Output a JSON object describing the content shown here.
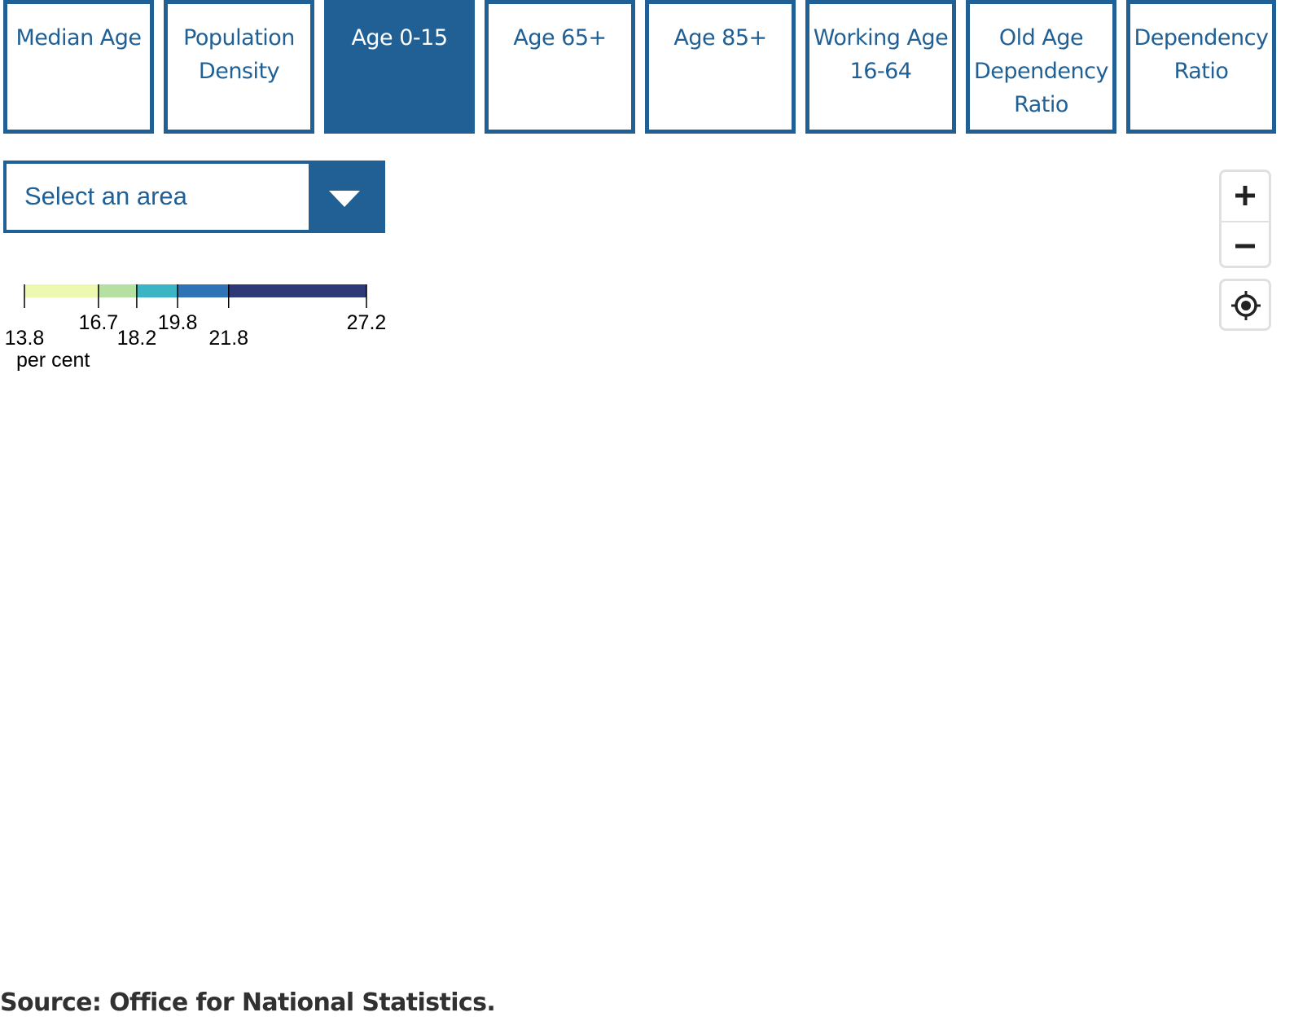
{
  "tabs": [
    {
      "label": "Median Age",
      "active": false
    },
    {
      "label": "Population\nDensity",
      "active": false
    },
    {
      "label": "Age 0-15",
      "active": true
    },
    {
      "label": "Age 65+",
      "active": false
    },
    {
      "label": "Age 85+",
      "active": false
    },
    {
      "label": "Working Age\n16-64",
      "active": false
    },
    {
      "label": "Old Age\nDependency\nRatio",
      "active": false
    },
    {
      "label": "Dependency\nRatio",
      "active": false
    }
  ],
  "area_select": {
    "label": "Select an area",
    "icon": "triangle-down-icon"
  },
  "map_controls": {
    "zoom_in_icon": "plus-icon",
    "zoom_out_icon": "minus-icon",
    "locate_icon": "crosshair-icon"
  },
  "chart_data": {
    "type": "heatmap",
    "legend_unit": "per cent",
    "breaks": [
      13.8,
      16.7,
      18.2,
      19.8,
      21.8,
      27.2
    ],
    "break_labels": [
      "13.8",
      "16.7",
      "18.2",
      "19.8",
      "21.8",
      "27.2"
    ],
    "colors": [
      "#edf8b1",
      "#b5e0a2",
      "#3bb5c4",
      "#2e73b6",
      "#2d3a75"
    ]
  },
  "footer": {
    "source": "Source: Office for National Statistics."
  },
  "colors": {
    "accent": "#206095",
    "source_text": "#323132"
  }
}
